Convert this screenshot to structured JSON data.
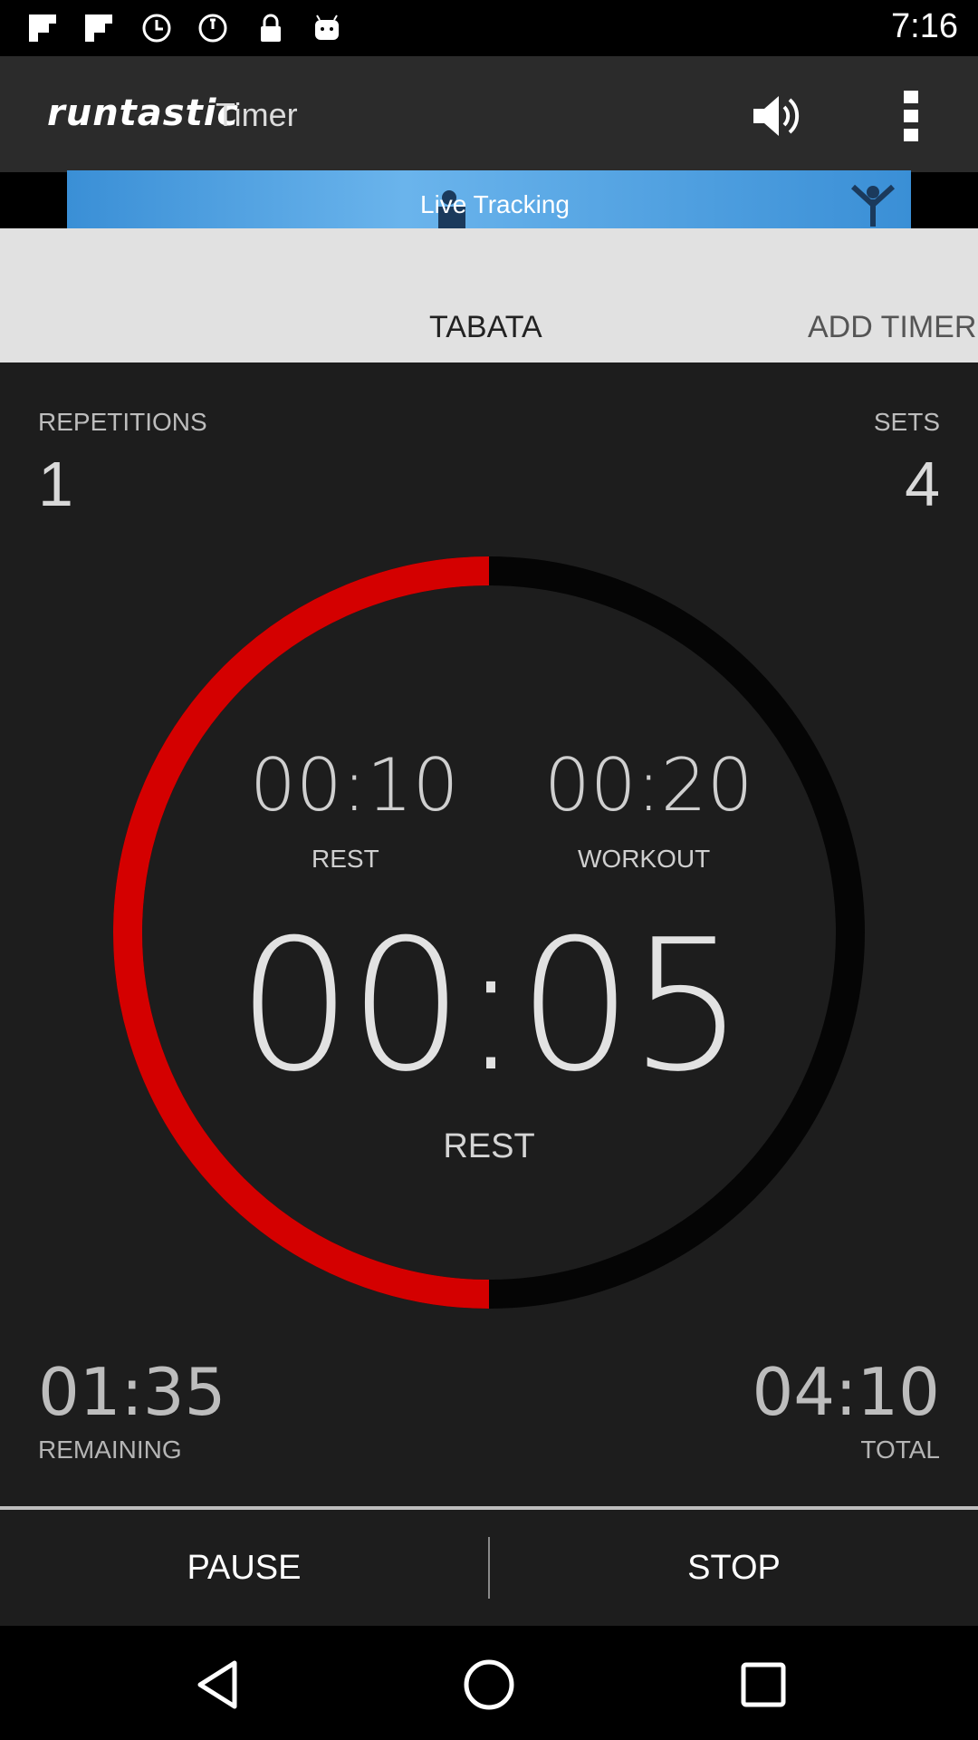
{
  "status_bar": {
    "time": "7:16",
    "icons": [
      "flipboard-icon",
      "flipboard-icon",
      "timer-icon",
      "timer-icon",
      "lock-icon",
      "android-icon"
    ]
  },
  "app_bar": {
    "logo": "runtastic",
    "title": "Timer",
    "sound_icon": "volume-icon",
    "menu_icon": "overflow-menu-icon"
  },
  "ad": {
    "text": "Live Tracking"
  },
  "tabs": {
    "active": "TABATA",
    "next": "ADD TIMER"
  },
  "stats": {
    "repetitions_label": "REPETITIONS",
    "repetitions_value": "1",
    "sets_label": "SETS",
    "sets_value": "4"
  },
  "dial": {
    "rest_time": "00:10",
    "rest_label": "REST",
    "workout_time": "00:20",
    "workout_label": "WORKOUT",
    "current_time": "00:05",
    "current_label": "REST",
    "progress_fraction": 0.5,
    "progress_color": "#d40000",
    "track_color": "#050505"
  },
  "footer": {
    "remaining_time": "01:35",
    "remaining_label": "REMAINING",
    "total_time": "04:10",
    "total_label": "TOTAL"
  },
  "actions": {
    "pause": "PAUSE",
    "stop": "STOP"
  },
  "nav": {
    "back": "back-icon",
    "home": "home-icon",
    "recents": "recents-icon"
  }
}
